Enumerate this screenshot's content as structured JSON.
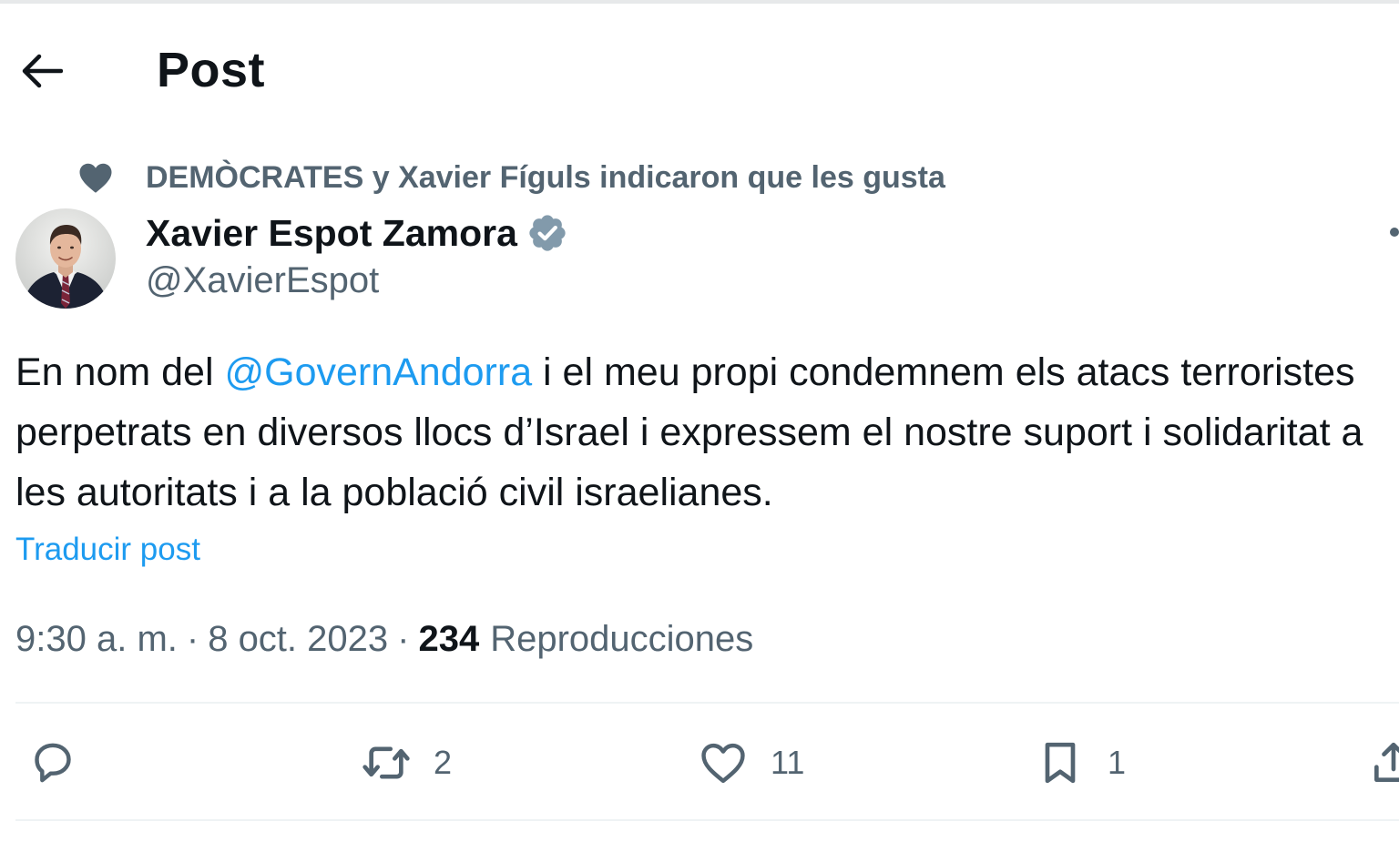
{
  "header": {
    "title": "Post",
    "back_icon": "arrow-left-icon"
  },
  "social_context": {
    "icon": "heart-filled-icon",
    "text": "DEMÒCRATES y Xavier Fíguls indicaron que les gusta"
  },
  "author": {
    "name": "Xavier Espot Zamora",
    "handle": "@XavierEspot",
    "verified": true,
    "verified_color": "#829aab"
  },
  "post": {
    "text_before_mention": "En nom del ",
    "mention": "@GovernAndorra",
    "text_after_mention": " i el meu propi condemnem els atacs terroristes perpetrats en diversos llocs d’Israel i expressem el nostre suport i solidaritat a les autoritats i a la població civil israelianes.",
    "translate_label": "Traducir post"
  },
  "meta": {
    "time": "9:30 a. m.",
    "separator": "·",
    "date": "8 oct. 2023",
    "views_count": "234",
    "views_label": "Reproducciones"
  },
  "actions": {
    "reply": {
      "icon": "reply-icon",
      "count": ""
    },
    "repost": {
      "icon": "repost-icon",
      "count": "2"
    },
    "like": {
      "icon": "heart-icon",
      "count": "11"
    },
    "bookmark": {
      "icon": "bookmark-icon",
      "count": "1"
    },
    "share": {
      "icon": "share-icon"
    }
  },
  "colors": {
    "link": "#1d9bf0",
    "secondary_text": "#536471",
    "primary_text": "#0f1419",
    "divider": "#eff3f4"
  }
}
